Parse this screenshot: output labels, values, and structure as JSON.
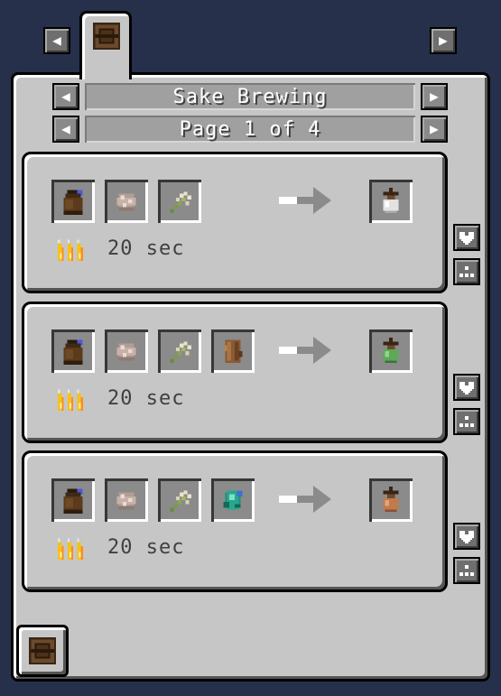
{
  "header": {
    "category_tab_icon": "barrel-icon",
    "prev_tab_glyph": "◀",
    "next_tab_glyph": "▶"
  },
  "recipe_navigator": {
    "title": "Sake Brewing",
    "page_label": "Page 1 of 4",
    "prev_glyph": "◀",
    "next_glyph": "▶"
  },
  "recipes": [
    {
      "inputs": [
        "rice-bag-icon",
        "rice-icon",
        "rice-plant-icon"
      ],
      "output": "white-sake-bottle-icon",
      "time_icon": "flames-icon",
      "time_label": "20 sec"
    },
    {
      "inputs": [
        "rice-bag-icon",
        "rice-icon",
        "rice-plant-icon",
        "wood-log-icon"
      ],
      "output": "green-sake-bottle-icon",
      "time_icon": "flames-icon",
      "time_label": "20 sec"
    },
    {
      "inputs": [
        "rice-bag-icon",
        "rice-icon",
        "rice-plant-icon",
        "teal-gem-icon"
      ],
      "output": "brown-sake-bottle-icon",
      "time_icon": "flames-icon",
      "time_label": "20 sec"
    }
  ],
  "side_buttons": [
    "bookmark-heart-icon",
    "crafting-grid-icon"
  ],
  "catalyst": {
    "icon": "barrel-icon"
  },
  "colors": {
    "panel": "#c6c6c6",
    "background": "#26304a",
    "button": "#6f6f6f"
  }
}
